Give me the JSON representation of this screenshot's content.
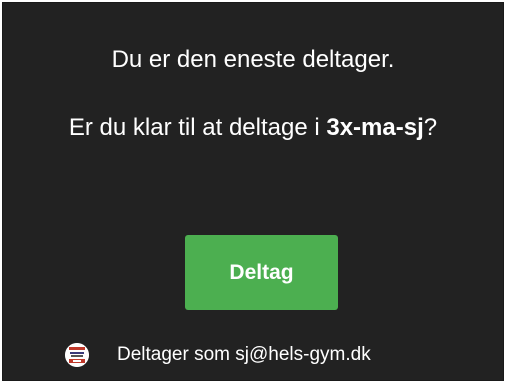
{
  "dialog": {
    "message_line1": "Du er den eneste deltager.",
    "question_prefix": "Er du klar til at deltage i ",
    "room_name": "3x-ma-sj",
    "question_suffix": "?",
    "join_button_label": "Deltag",
    "participant_text": "Deltager som sj@hels-gym.dk",
    "avatar_icon": "user-avatar-icon"
  },
  "colors": {
    "background": "#222222",
    "text": "#ffffff",
    "accent": "#4caf50"
  }
}
